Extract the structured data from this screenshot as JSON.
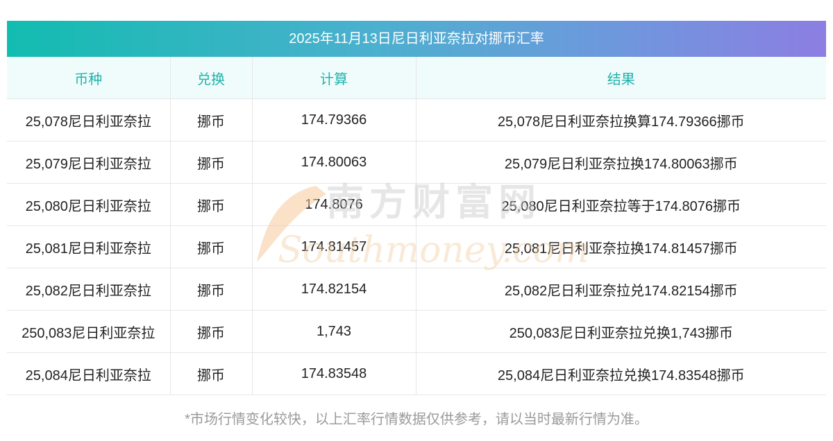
{
  "title": "2025年11月13日尼日利亚奈拉对挪币汇率",
  "table": {
    "headers": [
      "币种",
      "兑换",
      "计算",
      "结果"
    ],
    "rows": [
      [
        "25,078尼日利亚奈拉",
        "挪币",
        "174.79366",
        "25,078尼日利亚奈拉换算174.79366挪币"
      ],
      [
        "25,079尼日利亚奈拉",
        "挪币",
        "174.80063",
        "25,079尼日利亚奈拉换174.80063挪币"
      ],
      [
        "25,080尼日利亚奈拉",
        "挪币",
        "174.8076",
        "25,080尼日利亚奈拉等于174.8076挪币"
      ],
      [
        "25,081尼日利亚奈拉",
        "挪币",
        "174.81457",
        "25,081尼日利亚奈拉换174.81457挪币"
      ],
      [
        "25,082尼日利亚奈拉",
        "挪币",
        "174.82154",
        "25,082尼日利亚奈拉兑174.82154挪币"
      ],
      [
        "250,083尼日利亚奈拉",
        "挪币",
        "1,743",
        "250,083尼日利亚奈拉兑换1,743挪币"
      ],
      [
        "25,084尼日利亚奈拉",
        "挪币",
        "174.83548",
        "25,084尼日利亚奈拉兑换174.83548挪币"
      ]
    ]
  },
  "watermark": {
    "cn": "南方财富网",
    "en": "Southmoney.com"
  },
  "footnote": "*市场行情变化较快，以上汇率行情数据仅供参考，请以当时最新行情为准。",
  "colors": {
    "header_text": "#1fb3ab",
    "header_bg": "#f0fcfc",
    "title_gradient_start": "#12bcb0",
    "title_gradient_end": "#8c7ee2"
  }
}
